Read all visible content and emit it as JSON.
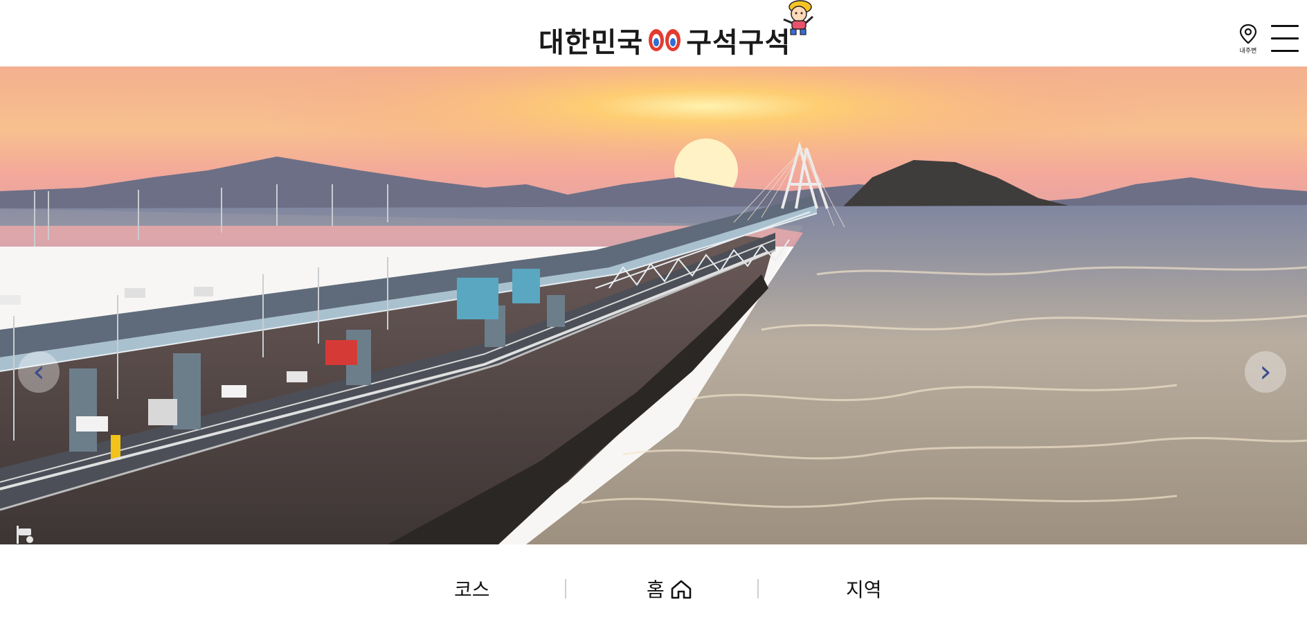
{
  "header": {
    "logo_text_left": "대한민국",
    "logo_text_right": "구석구석",
    "location_label": "내주변",
    "icons": {
      "location": "map-pin-icon",
      "menu": "hamburger-menu-icon",
      "mascot": "mascot-character-icon"
    }
  },
  "hero": {
    "image": "bridge-sunset-tidal-flat-photo",
    "prev_icon": "chevron-left-icon",
    "next_icon": "chevron-right-icon",
    "prev_glyph": "‹",
    "next_glyph": "›"
  },
  "bottom_nav": {
    "items": [
      {
        "label": "코스"
      },
      {
        "label": "홈",
        "icon": "home-icon"
      },
      {
        "label": "지역"
      }
    ]
  },
  "colors": {
    "sky_top": "#f4a88c",
    "sun": "#ffe089",
    "sea": "#b7aa9c",
    "road": "#4a4e55",
    "text": "#111111"
  }
}
